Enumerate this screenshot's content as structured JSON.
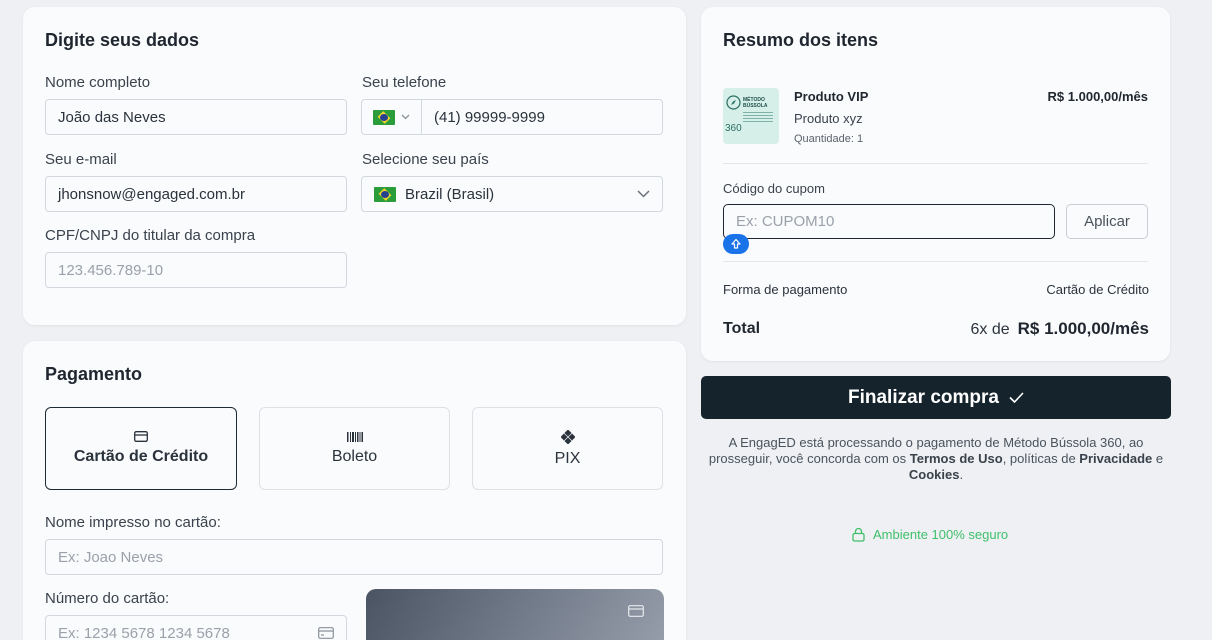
{
  "dados": {
    "title": "Digite seus dados",
    "nome_label": "Nome completo",
    "nome_value": "João das Neves",
    "telefone_label": "Seu telefone",
    "telefone_value": "(41) 99999-9999",
    "email_label": "Seu e-mail",
    "email_value": "jhonsnow@engaged.com.br",
    "pais_label": "Selecione seu país",
    "pais_value": "Brazil (Brasil)",
    "cpf_label": "CPF/CNPJ do titular da compra",
    "cpf_placeholder": "123.456.789-10"
  },
  "pagamento": {
    "title": "Pagamento",
    "options": [
      {
        "label": "Cartão de Crédito",
        "icon": "credit-card-icon",
        "selected": true
      },
      {
        "label": "Boleto",
        "icon": "barcode-icon",
        "selected": false
      },
      {
        "label": "PIX",
        "icon": "pix-icon",
        "selected": false
      }
    ],
    "nome_cartao_label": "Nome impresso no cartão:",
    "nome_cartao_placeholder": "Ex: Joao Neves",
    "numero_label": "Número do cartão:",
    "numero_placeholder": "Ex: 1234 5678 1234 5678"
  },
  "resumo": {
    "title": "Resumo dos itens",
    "produto_nome": "Produto VIP",
    "produto_preco": "R$ 1.000,00/mês",
    "produto_desc": "Produto xyz",
    "produto_qtd": "Quantidade: 1",
    "thumb_title": "MÉTODO BÚSSOLA",
    "thumb_num": "360",
    "cupom_label": "Código do cupom",
    "cupom_placeholder": "Ex: CUPOM10",
    "aplicar_label": "Aplicar",
    "forma_label": "Forma de pagamento",
    "forma_value": "Cartão de Crédito",
    "total_label": "Total",
    "total_parcelas": "6x de",
    "total_valor": "R$ 1.000,00/mês"
  },
  "finalizar_label": "Finalizar compra",
  "legal": {
    "p1": "A EngagED está processando o pagamento de Método Bússola 360, ao prosseguir, você concorda com os ",
    "termos": "Termos de Uso",
    "p2": ", políticas de ",
    "privacidade": "Privacidade",
    "p3": " e ",
    "cookies": "Cookies",
    "p4": "."
  },
  "secure_text": "Ambiente 100% seguro",
  "colors": {
    "primary_dark": "#15232c",
    "secure_green": "#3fbf6a",
    "focus_blue": "#1a73e8"
  }
}
